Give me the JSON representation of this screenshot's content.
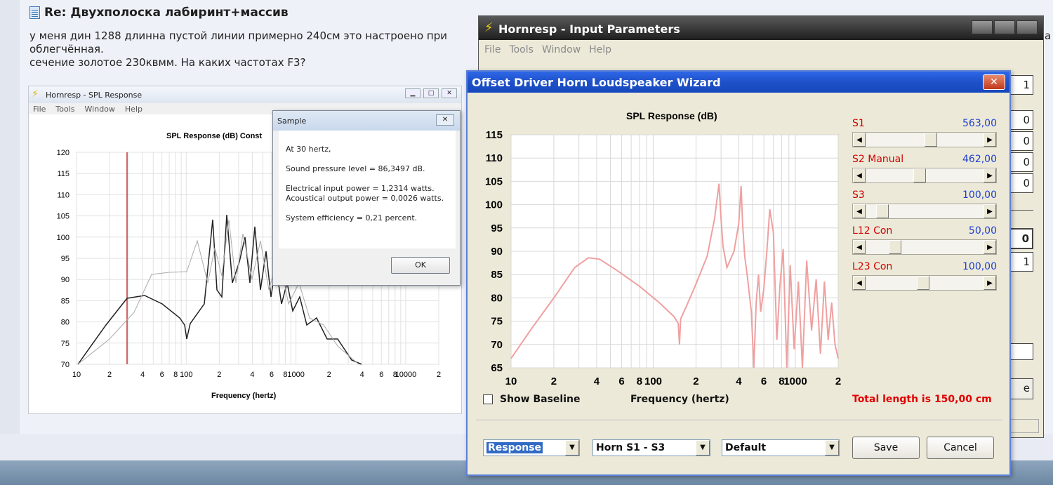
{
  "post": {
    "title": "Re: Двухполоска лабиринт+массив",
    "lines": [
      "у меня дин 1288 длинна пустой линии примерно 240см это настроено при",
      "облегчённая.",
      "сечение золотое 230квмм. На каких частотах F3?"
    ],
    "overflow_right": "a"
  },
  "image": {
    "window_title": "Hornresp - SPL Response",
    "menu": [
      "File",
      "Tools",
      "Window",
      "Help"
    ],
    "chart_title": "SPL Response (dB)   Const",
    "xlabel": "Frequency (hertz)",
    "y_ticks": [
      "120",
      "115",
      "110",
      "105",
      "100",
      "95",
      "90",
      "85",
      "80",
      "75",
      "70"
    ],
    "x_ticks": [
      "10",
      "2",
      "4",
      "6",
      "8",
      "100",
      "2",
      "4",
      "6",
      "8",
      "1000",
      "2",
      "4",
      "6",
      "8",
      "10000",
      "2"
    ],
    "sample_dialog": {
      "title": "Sample",
      "lines": [
        "At 30 hertz,",
        "Sound pressure level = 86,3497 dB.",
        "Electrical input power = 1,2314 watts.",
        "Acoustical output power = 0,0026 watts.",
        "System efficiency = 0,21 percent."
      ],
      "ok_label": "OK"
    }
  },
  "hornresp": {
    "title": "Hornresp - Input Parameters",
    "menu": [
      "File",
      "Tools",
      "Window",
      "Help"
    ],
    "fields": [
      "1",
      "0",
      "0",
      "0",
      "0",
      "0",
      "1",
      "e"
    ]
  },
  "wizard": {
    "title": "Offset Driver Horn Loudspeaker Wizard",
    "close_label": "✕",
    "params": [
      {
        "name": "S1",
        "value": "563,00",
        "level": 0.55
      },
      {
        "name": "S2  Manual",
        "value": "462,00",
        "level": 0.45
      },
      {
        "name": "S3",
        "value": "100,00",
        "level": 0.1
      },
      {
        "name": "L12  Con",
        "value": "50,00",
        "level": 0.22
      },
      {
        "name": "L23  Con",
        "value": "100,00",
        "level": 0.48
      }
    ],
    "show_baseline": "Show Baseline",
    "freq_label": "Frequency (hertz)",
    "total_length": "Total length is 150,00 cm",
    "dropdowns": [
      "Response",
      "Horn S1 - S3",
      "Default"
    ],
    "save_label": "Save",
    "cancel_label": "Cancel"
  },
  "chart_data": {
    "type": "line",
    "title": "SPL Response (dB)",
    "xlabel": "Frequency (hertz)",
    "ylabel": "",
    "x_scale": "log",
    "xlim": [
      10,
      2000
    ],
    "ylim": [
      65,
      115
    ],
    "y_ticks": [
      115,
      110,
      105,
      100,
      95,
      90,
      85,
      80,
      75,
      70,
      65
    ],
    "x_tick_labels": [
      "10",
      "2",
      "4",
      "6",
      "8",
      "100",
      "2",
      "4",
      "6",
      "8",
      "1000",
      "2"
    ],
    "grid": true,
    "series": [
      {
        "color": "#f0a0a0",
        "x": [
          10,
          14,
          20,
          28,
          35,
          42,
          55,
          80,
          110,
          140,
          150,
          153,
          156,
          170,
          200,
          240,
          270,
          290,
          300,
          310,
          330,
          370,
          400,
          415,
          425,
          440,
          460,
          490,
          510,
          530,
          550,
          570,
          600,
          630,
          660,
          700,
          740,
          780,
          820,
          870,
          920,
          980,
          1050,
          1120,
          1200,
          1300,
          1400,
          1500,
          1600,
          1700,
          1800,
          1900,
          2000
        ],
        "y": [
          67,
          73.5,
          80,
          86.5,
          88.6,
          88.3,
          86,
          82.5,
          79,
          76,
          74.5,
          70,
          75.5,
          78,
          83,
          89,
          97,
          104.5,
          97,
          91,
          86.5,
          90,
          96,
          104,
          96,
          89,
          84.5,
          77,
          65,
          79,
          85,
          77,
          82,
          90,
          99,
          94,
          71,
          83,
          90.5,
          65,
          87,
          69,
          83.5,
          65,
          88,
          73,
          84,
          68,
          83.5,
          71,
          79,
          70,
          67
        ]
      }
    ]
  }
}
